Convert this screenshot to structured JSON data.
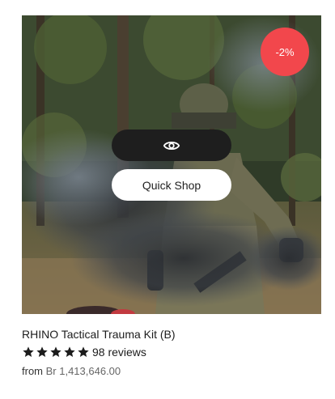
{
  "product": {
    "discount_badge": "-2%",
    "quick_shop_label": "Quick Shop",
    "title": "RHINO Tactical Trauma Kit (B)",
    "rating": 5,
    "reviews_label": "98 reviews",
    "price_prefix": "from",
    "price": "Br 1,413,646.00",
    "image_subject": "soldier in camouflage with smoke grenade in forest"
  },
  "icons": {
    "quick_view": "eye-icon",
    "star": "star-icon"
  },
  "colors": {
    "badge": "#f2474c",
    "quick_view_button": "#1e1e1e",
    "quick_shop_button": "#ffffff",
    "star": "#1c1c1c"
  }
}
